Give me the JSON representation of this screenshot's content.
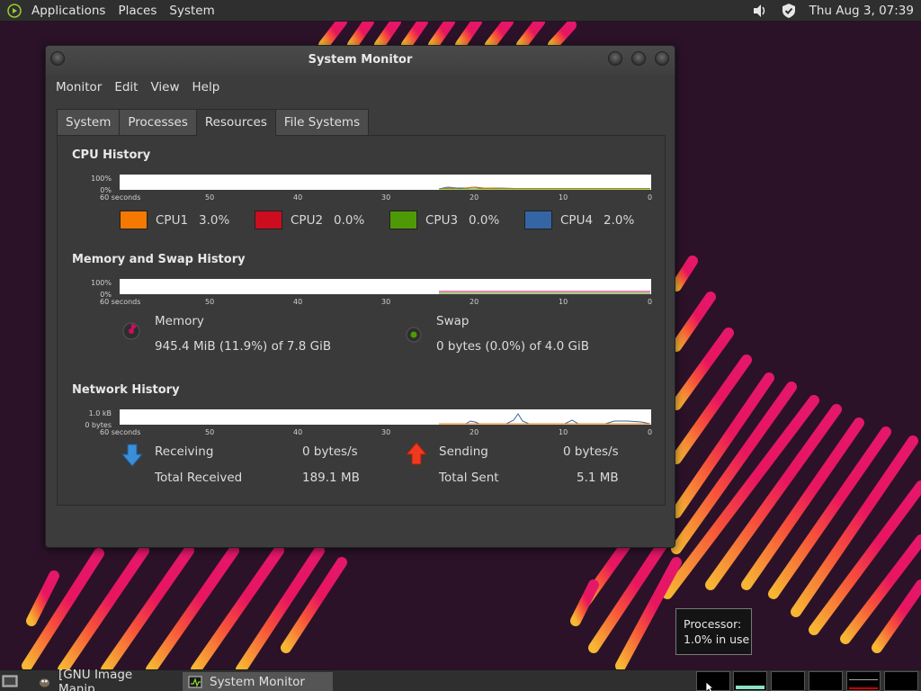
{
  "top_panel": {
    "menus": [
      "Applications",
      "Places",
      "System"
    ],
    "clock": "Thu Aug  3, 07:39",
    "icons": [
      "volume-icon",
      "shield-icon"
    ]
  },
  "window": {
    "title": "System Monitor",
    "menubar": [
      "Monitor",
      "Edit",
      "View",
      "Help"
    ],
    "tabs": [
      "System",
      "Processes",
      "Resources",
      "File Systems"
    ],
    "active_tab": "Resources"
  },
  "cpu": {
    "title": "CPU History",
    "y_top": "100%",
    "y_bottom": "0%",
    "x_labels": [
      "60 seconds",
      "50",
      "40",
      "30",
      "20",
      "10",
      "0"
    ],
    "cores": [
      {
        "label": "CPU1",
        "value": "3.0%",
        "color": "#f57900"
      },
      {
        "label": "CPU2",
        "value": "0.0%",
        "color": "#cc0d1f"
      },
      {
        "label": "CPU3",
        "value": "0.0%",
        "color": "#4e9a06"
      },
      {
        "label": "CPU4",
        "value": "2.0%",
        "color": "#3465a4"
      }
    ]
  },
  "memory": {
    "title": "Memory and Swap History",
    "y_top": "100%",
    "y_bottom": "0%",
    "x_labels": [
      "60 seconds",
      "50",
      "40",
      "30",
      "20",
      "10",
      "0"
    ],
    "memory_label": "Memory",
    "memory_value": "945.4 MiB (11.9%) of 7.8 GiB",
    "memory_color": "#cc0d60",
    "swap_label": "Swap",
    "swap_value": "0 bytes (0.0%) of 4.0 GiB",
    "swap_color": "#4e9a06"
  },
  "network": {
    "title": "Network History",
    "y_top": "1.0 kB",
    "y_bottom": "0 bytes",
    "x_labels": [
      "60 seconds",
      "50",
      "40",
      "30",
      "20",
      "10",
      "0"
    ],
    "receiving_label": "Receiving",
    "receiving_value": "0 bytes/s",
    "total_received_label": "Total Received",
    "total_received_value": "189.1 MB",
    "sending_label": "Sending",
    "sending_value": "0 bytes/s",
    "total_sent_label": "Total Sent",
    "total_sent_value": "5.1 MB"
  },
  "tooltip": {
    "line1": "Processor:",
    "line2": "1.0% in use"
  },
  "taskbar": {
    "tasks": [
      "[GNU Image Manip...",
      "System Monitor"
    ],
    "active_task": "System Monitor"
  }
}
